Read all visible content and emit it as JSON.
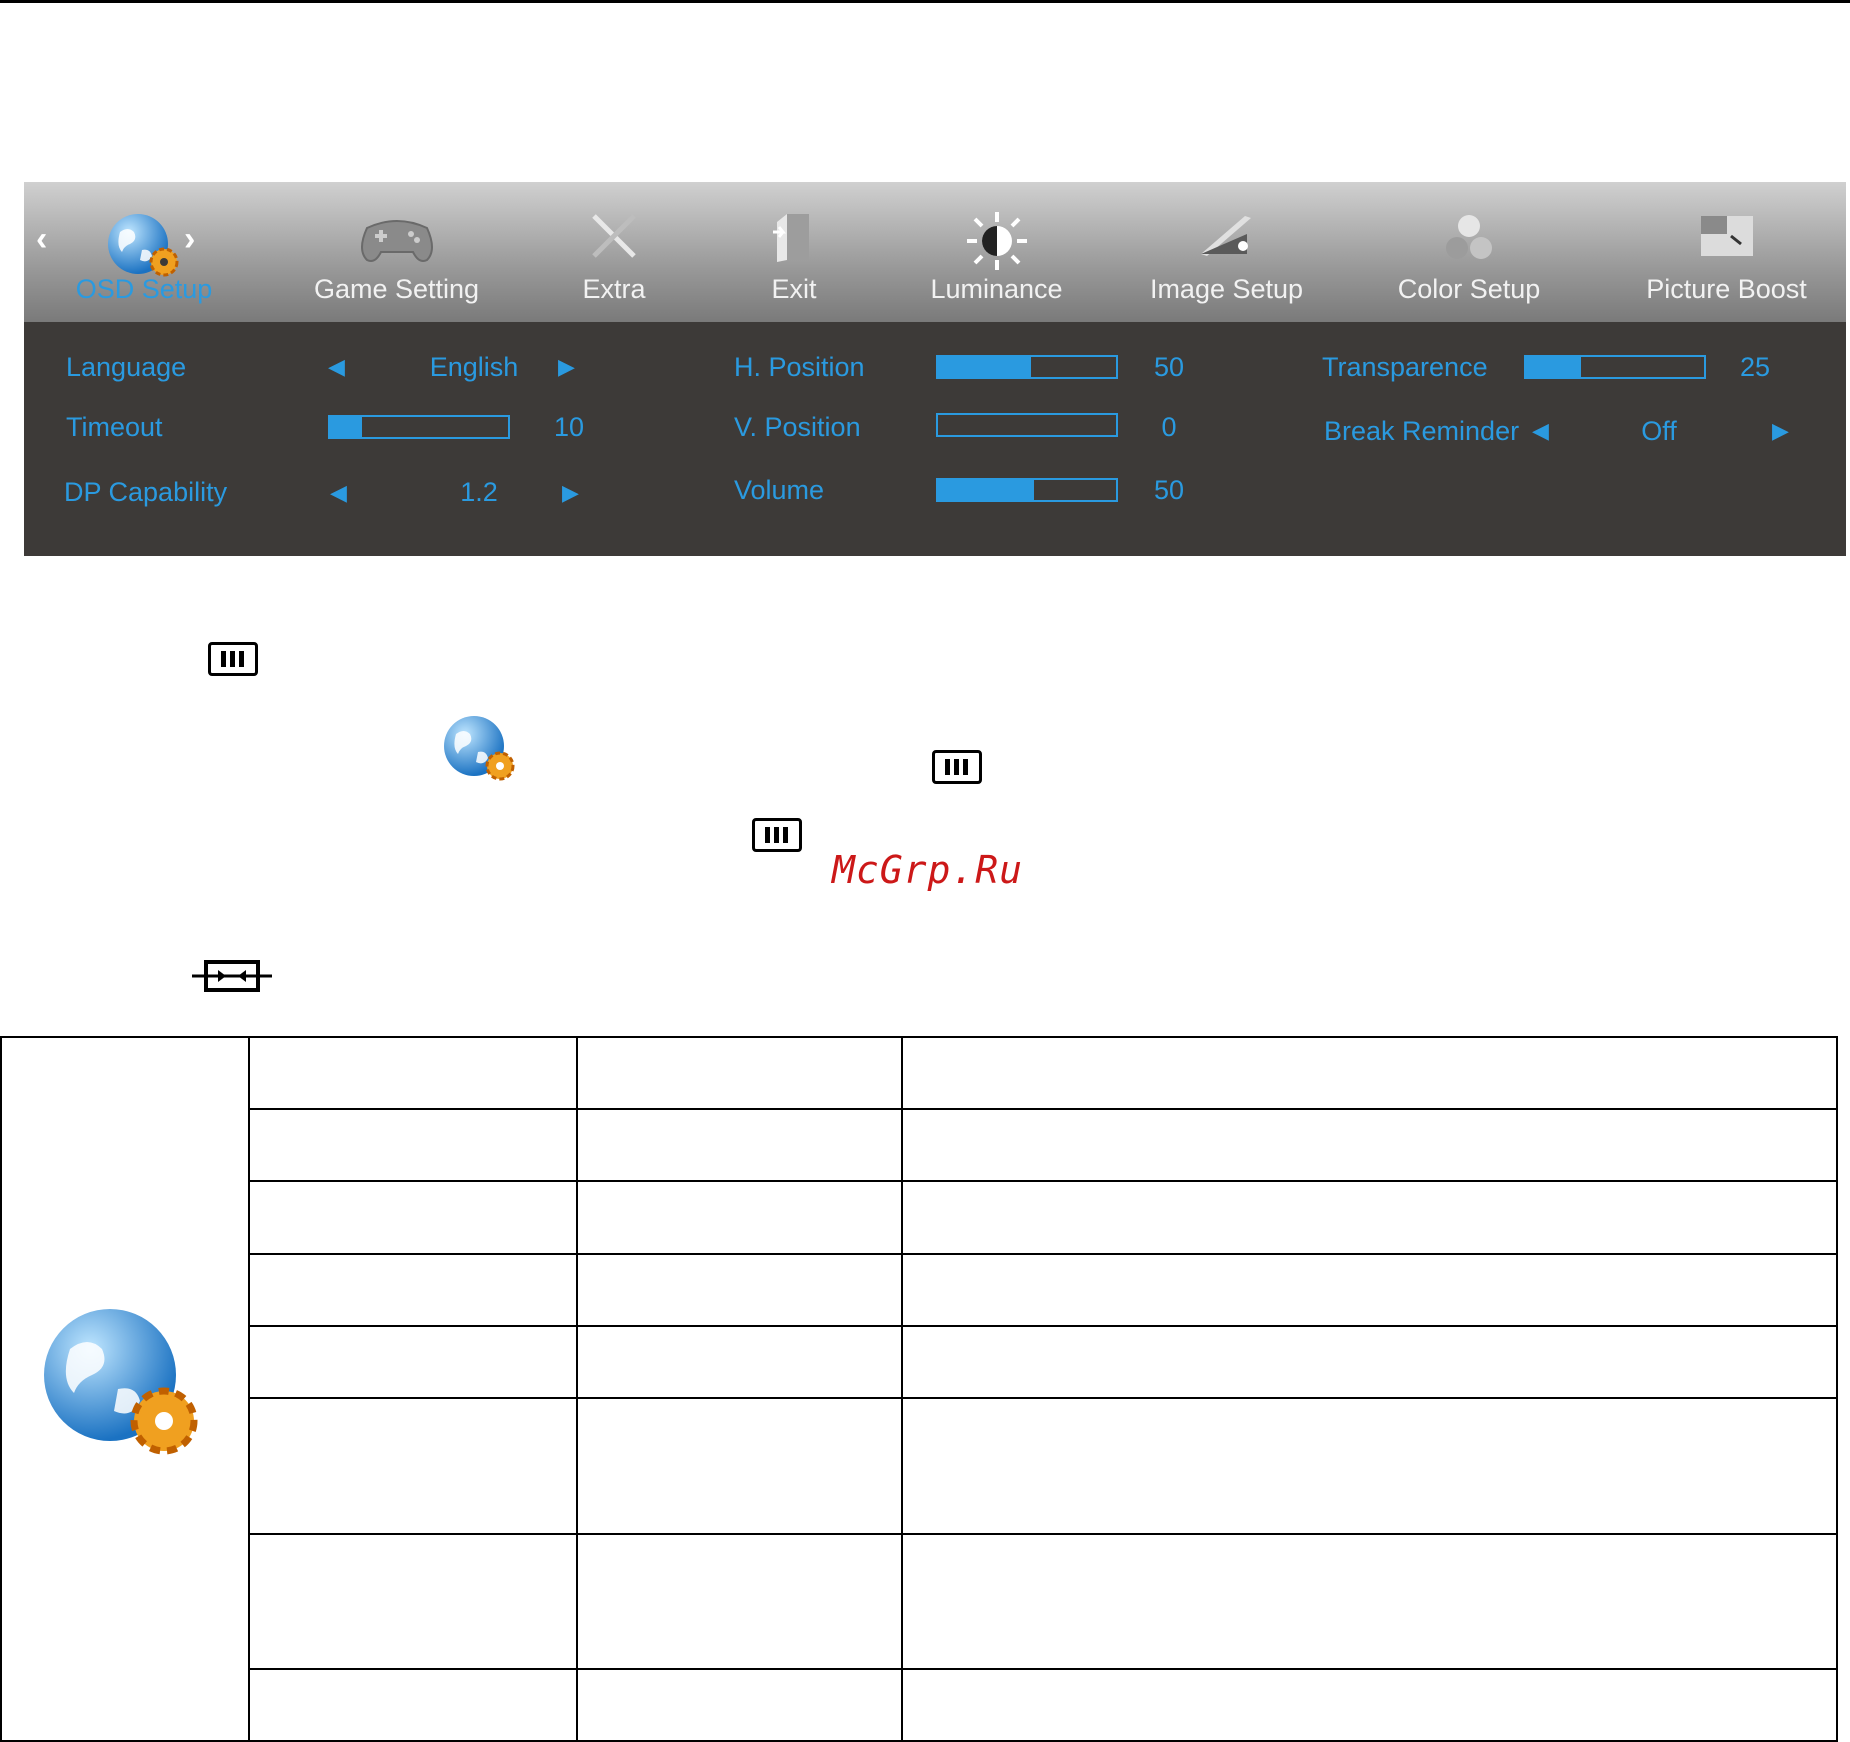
{
  "tabs": [
    {
      "label": "OSD Setup",
      "icon": "osd-setup-icon",
      "active": true
    },
    {
      "label": "Game Setting",
      "icon": "gamepad-icon"
    },
    {
      "label": "Extra",
      "icon": "tools-icon"
    },
    {
      "label": "Exit",
      "icon": "exit-icon"
    },
    {
      "label": "Luminance",
      "icon": "sun-icon"
    },
    {
      "label": "Image Setup",
      "icon": "image-setup-icon"
    },
    {
      "label": "Color Setup",
      "icon": "color-setup-icon"
    },
    {
      "label": "Picture Boost",
      "icon": "picture-boost-icon"
    }
  ],
  "settings": {
    "language": {
      "label": "Language",
      "value": "English"
    },
    "timeout": {
      "label": "Timeout",
      "value": "10",
      "level": 0.18
    },
    "dp_capability": {
      "label": "DP Capability",
      "value": "1.2"
    },
    "h_position": {
      "label": "H. Position",
      "value": "50",
      "level": 0.52
    },
    "v_position": {
      "label": "V. Position",
      "value": "0",
      "level": 0.0
    },
    "volume": {
      "label": "Volume",
      "value": "50",
      "level": 0.54
    },
    "transparence": {
      "label": "Transparence",
      "value": "25",
      "level": 0.31
    },
    "break_reminder": {
      "label": "Break Reminder",
      "value": "Off"
    }
  },
  "watermark": "McGrp.Ru",
  "colors": {
    "accent": "#2a9ae0",
    "panel": "#3d3a38"
  }
}
